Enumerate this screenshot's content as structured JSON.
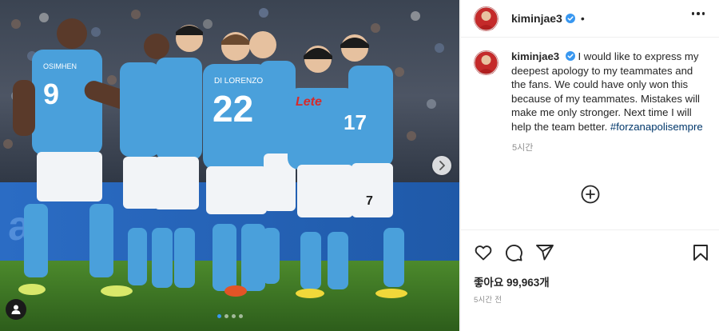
{
  "post": {
    "username": "kiminjae3",
    "header_separator": "•",
    "caption": {
      "username": "kiminjae3",
      "text": "I would like to express my deepest apology to my teammates and the fans. We could have only won this because of my teammates. Mistakes will make me only stronger. Next time I will help the team better.",
      "hashtag": "#forzanapolisempre"
    },
    "caption_time": "5시간",
    "likes": "좋아요 99,963개",
    "timestamp": "5시간 전"
  },
  "media": {
    "carousel_total": 4,
    "carousel_active_index": 0,
    "jerseys": {
      "left_player_name": "OSIMHEN",
      "left_player_number": "9",
      "center_player_name": "DI LORENZO",
      "center_player_number": "22",
      "right_number_a": "17",
      "right_number_b": "7",
      "sponsor": "Lete"
    }
  },
  "icons": {
    "verified": "verified-badge-icon",
    "more": "more-options-icon",
    "load_more": "load-more-comments-icon",
    "like": "heart-icon",
    "comment": "comment-icon",
    "share": "share-icon",
    "save": "bookmark-icon",
    "next": "chevron-right-icon",
    "tags": "user-tag-icon"
  },
  "colors": {
    "verified": "#3897f0",
    "jersey": "#4aa0db",
    "hashtag": "#00376b",
    "secondary_text": "#8e8e8e"
  }
}
